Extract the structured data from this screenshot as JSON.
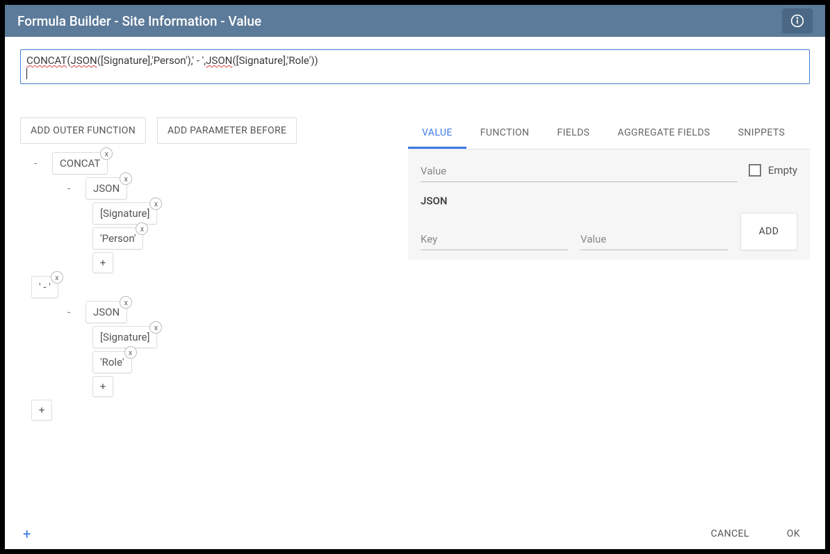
{
  "titlebar": {
    "title": "Formula Builder - Site Information - Value"
  },
  "formula": {
    "segments": [
      {
        "t": "CONCAT",
        "u": true
      },
      {
        "t": "(",
        "u": false
      },
      {
        "t": "JSON",
        "u": true
      },
      {
        "t": "([Signature],'Person'),' - ',",
        "u": false
      },
      {
        "t": "JSON",
        "u": true
      },
      {
        "t": "([Signature],'Role'))",
        "u": false
      }
    ]
  },
  "buttons": {
    "add_outer": "ADD OUTER FUNCTION",
    "add_param_before": "ADD PARAMETER BEFORE"
  },
  "tree": {
    "concat": "CONCAT",
    "json": "JSON",
    "sig": "[Signature]",
    "person": "'Person'",
    "sep": "' - '",
    "role": "'Role'",
    "plus": "+",
    "minus": "-",
    "x": "x"
  },
  "tabs": {
    "value": "VALUE",
    "function": "FUNCTION",
    "fields": "FIELDS",
    "aggregate": "AGGREGATE FIELDS",
    "snippets": "SNIPPETS"
  },
  "panel": {
    "value_placeholder": "Value",
    "empty_label": "Empty",
    "json_heading": "JSON",
    "key_placeholder": "Key",
    "value2_placeholder": "Value",
    "add": "ADD"
  },
  "footer": {
    "cancel": "CANCEL",
    "ok": "OK"
  }
}
